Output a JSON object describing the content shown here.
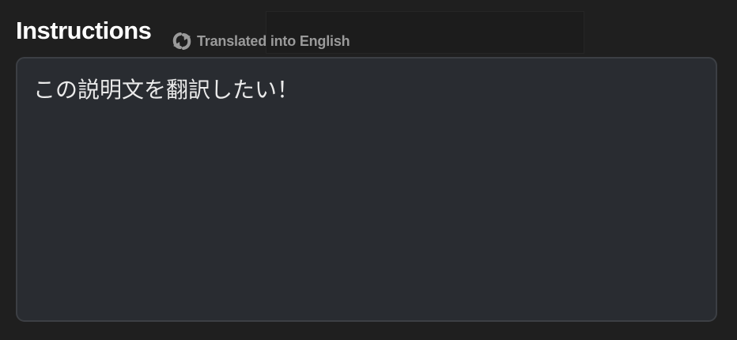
{
  "instructions": {
    "title": "Instructions",
    "translated_label": "Translated into English",
    "translate_icon": "translate-refresh-icon",
    "text_value": "この説明文を翻訳したい！"
  }
}
